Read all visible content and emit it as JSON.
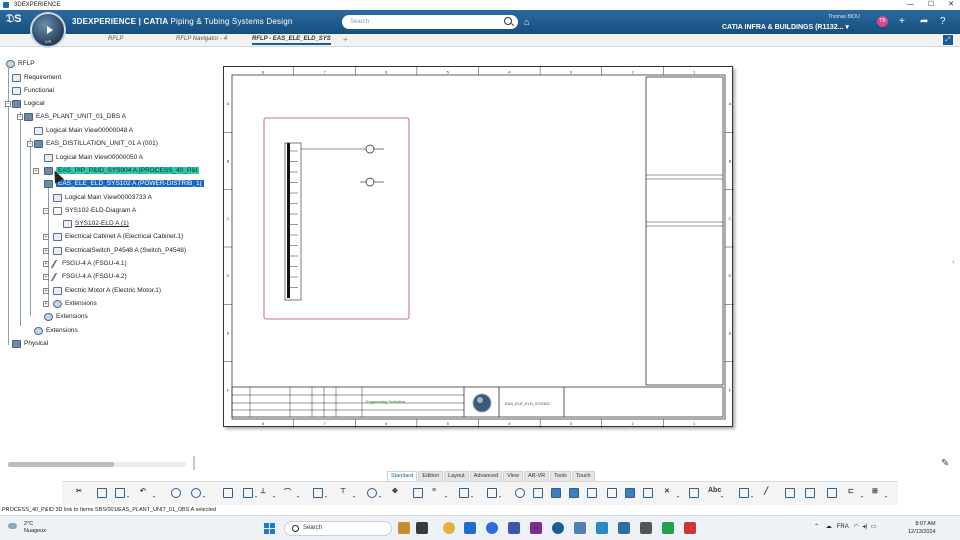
{
  "os_title": "3DEXPERIENCE",
  "window_controls": {
    "minimize": "—",
    "maximize": "☐",
    "close": "✕"
  },
  "header": {
    "brand_bold": "3DEXPERIENCE | CATIA",
    "brand_app": "Piping & Tubing Systems Design",
    "search_placeholder": "Search",
    "user_name": "Thomas BIOU",
    "platform": "CATIA INFRA & BUILDINGS (R1132... ▾",
    "avatar_initials": "TB",
    "compass_version": "V.R"
  },
  "tabs": [
    {
      "label": "RFLP"
    },
    {
      "label": "RFLP Navigator - 4"
    },
    {
      "label": "RFLP - EAS_ELE_ELD_SYS"
    }
  ],
  "tree": {
    "root": "RFLP",
    "requirement": "Requirement",
    "functional": "Functional",
    "logical": "Logical",
    "plant_unit": "EAS_PLANT_UNIT_01_DBS A",
    "main_view_48": "Logical Main View00000048 A",
    "distillation": "EAS_DISTILLATION_UNIT_01 A (001)",
    "main_view_50": "Logical Main View00000050 A",
    "pip_sys": "EAS_PIP_P&ID_SYS004 A (PROCESS_40_P&I",
    "ele_sys": "EAS_ELE_ELD_SYS102 A (POWER-DISTRIB_1(",
    "main_view_3733": "Logical Main View00003733 A",
    "diagram": "SYS102-ELD-Diagram A",
    "eld": "SYS102-ELD A (1)",
    "cabinet": "Electrical Cabinet A (Electrical Cabinet.1)",
    "switch": "ElectricalSwitch_P4548 A (Switch_P4548)",
    "fsgu1": "FSGU-4 A (FSGU-4.1)",
    "fsgu2": "FSGU-4 A (FSGU-4.2)",
    "motor": "Electric Motor A (Electric Motor.1)",
    "extensions_inner": "Extensions",
    "extensions_mid": "Extensions",
    "extensions_outer": "Extensions",
    "physical": "Physical"
  },
  "sheet": {
    "col_labels": [
      "8",
      "7",
      "6",
      "5",
      "4",
      "3",
      "2",
      "1"
    ],
    "row_labels": [
      "A",
      "B",
      "C",
      "D",
      "E",
      "F"
    ],
    "title_text": "Engineering Definition",
    "drawing_name": "EAS_ELE_ELD_SYS102"
  },
  "action_tabs": [
    "Standard",
    "Edition",
    "Layout",
    "Advanced",
    "View",
    "AR-VR",
    "Tools",
    "Touch"
  ],
  "status_text": "PROCESS_40_P&ID 3D link to Items SBS/001/EAS_PLANT_UNIT_01_DBS A selected",
  "taskbar": {
    "temperature": "2°C",
    "weather": "Nuageux",
    "search": "Search",
    "language": "FRA",
    "time": "8:07 AM",
    "date": "12/13/2024"
  },
  "colors": {
    "header": "#1d5d93",
    "highlight_green": "#2cc9a4",
    "highlight_blue": "#1a66c9"
  }
}
